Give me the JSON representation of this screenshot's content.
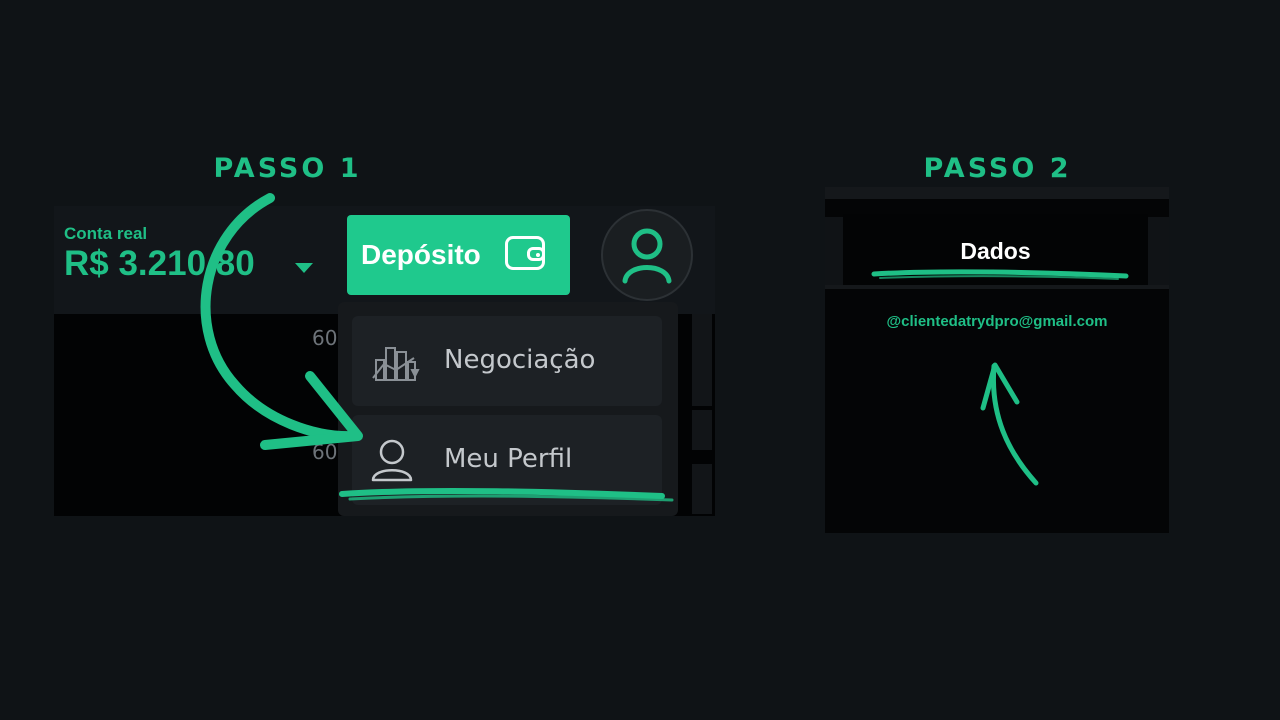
{
  "step1": {
    "title": "PASSO 1",
    "account_label": "Conta real",
    "balance": "R$ 3.210,80",
    "deposit_label": "Depósito",
    "axis_labels": [
      "60",
      "60"
    ],
    "menu": [
      {
        "label": "Negociação",
        "icon": "buildings-chart-icon"
      },
      {
        "label": "Meu Perfil",
        "icon": "user-outline-icon"
      }
    ]
  },
  "step2": {
    "title": "PASSO 2",
    "tab_label": "Dados",
    "email": "@clientedatrydpro@gmail.com"
  },
  "colors": {
    "accent": "#1fbf86",
    "button": "#1fc98d",
    "background": "#0f1316"
  }
}
